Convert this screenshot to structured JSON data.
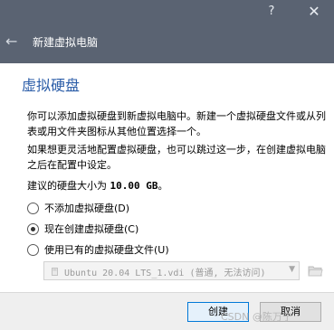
{
  "window": {
    "help_label": "?",
    "close_label": "✕"
  },
  "header": {
    "back_label": "←",
    "title": "新建虚拟电脑"
  },
  "page": {
    "title": "虚拟硬盘",
    "paragraph1": "你可以添加虚拟硬盘到新虚拟电脑中。新建一个虚拟硬盘文件或从列表或用文件夹图标从其他位置选择一个。",
    "paragraph2": "如果想更灵活地配置虚拟硬盘，也可以跳过这一步，在创建虚拟电脑之后在配置中设定。",
    "size_prefix": "建议的硬盘大小为",
    "size_value": "10.00 GB",
    "size_suffix": "。"
  },
  "options": [
    {
      "label": "不添加虚拟硬盘(D)",
      "checked": false
    },
    {
      "label": "现在创建虚拟硬盘(C)",
      "checked": true
    },
    {
      "label": "使用已有的虚拟硬盘文件(U)",
      "checked": false
    }
  ],
  "existing_disk": {
    "selected": "Ubuntu 20.04 LTS_1.vdi (普通, 无法访问)",
    "icon": "disk-icon"
  },
  "buttons": {
    "create": "创建",
    "cancel": "取消"
  },
  "watermark": "CSDN @陈万宁",
  "colors": {
    "header_bg": "#5a6372",
    "title_blue": "#2b5da8",
    "default_button_border": "#0078d7"
  }
}
